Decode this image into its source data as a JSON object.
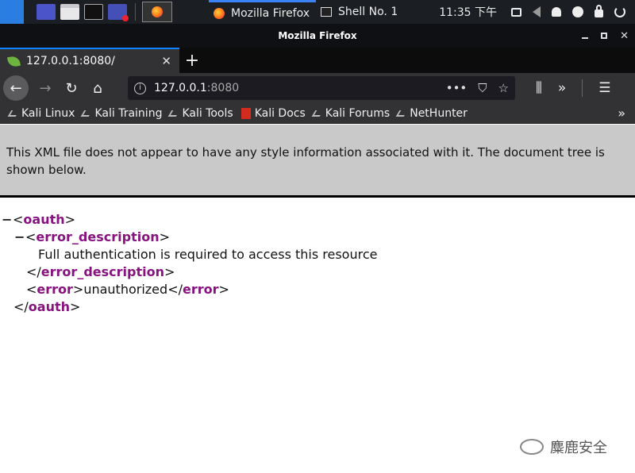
{
  "taskbar": {
    "tasks": [
      {
        "icon": "firefox-icon",
        "label": "Mozilla Firefox"
      },
      {
        "icon": "terminal-icon",
        "label": "Shell No. 1"
      }
    ],
    "clock": "11:35 下午"
  },
  "window": {
    "title": "Mozilla Firefox"
  },
  "tabs": [
    {
      "title": "127.0.0.1:8080/",
      "icon": "spring-leaf-icon"
    }
  ],
  "urlbar": {
    "host": "127.0.0.1",
    "port": ":8080"
  },
  "bookmarks": [
    {
      "label": "Kali Linux",
      "icon": "kali-dragon-icon"
    },
    {
      "label": "Kali Training",
      "icon": "kali-dragon-icon"
    },
    {
      "label": "Kali Tools",
      "icon": "kali-dragon-icon"
    },
    {
      "label": "Kali Docs",
      "icon": "kali-docs-icon"
    },
    {
      "label": "Kali Forums",
      "icon": "kali-dragon-icon"
    },
    {
      "label": "NetHunter",
      "icon": "nethunter-icon"
    }
  ],
  "xml_note": "This XML file does not appear to have any style information associated with it. The document tree is shown below.",
  "xml": {
    "root_tag": "oauth",
    "desc_tag": "error_description",
    "desc_text": "Full authentication is required to access this resource",
    "error_tag": "error",
    "error_text": "unauthorized",
    "collapse_glyph": "−"
  },
  "watermark": "麋鹿安全",
  "colors": {
    "tag": "#881280",
    "accent": "#0a84ff",
    "banner": "#c9c9c9"
  }
}
